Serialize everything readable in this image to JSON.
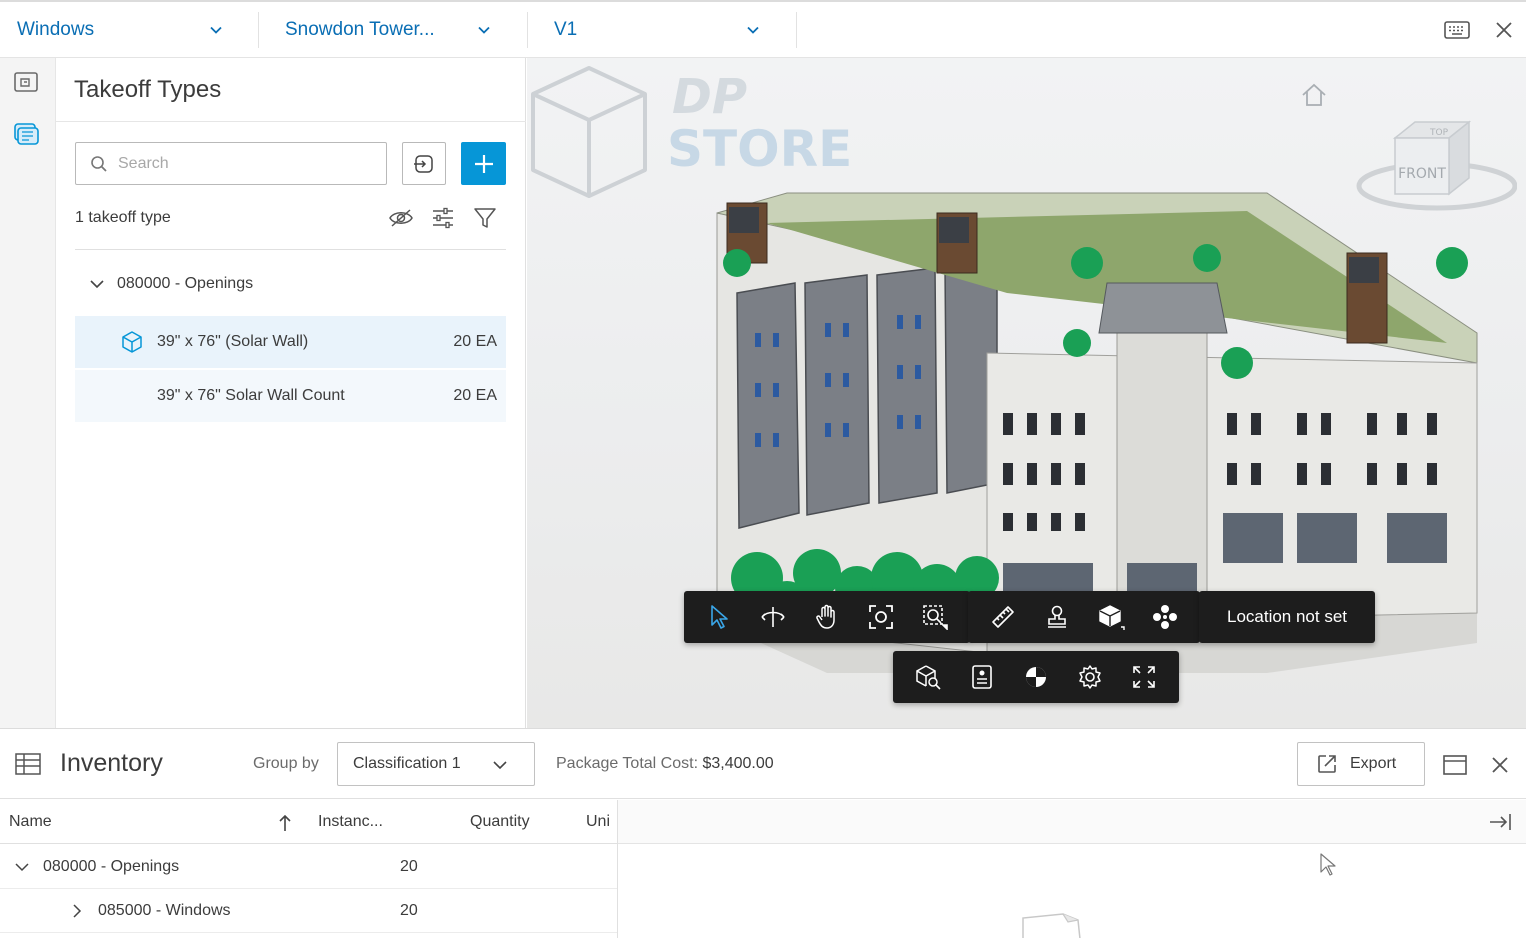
{
  "topbar": {
    "dropdown1": "Windows",
    "dropdown2": "Snowdon Tower...",
    "dropdown3": "V1"
  },
  "panel": {
    "title": "Takeoff Types",
    "search_placeholder": "Search",
    "count_text": "1 takeoff type",
    "group_label": "080000 - Openings",
    "items": [
      {
        "label": "39\" x 76\" (Solar Wall)",
        "qty": "20 EA"
      },
      {
        "label": "39\" x 76\" Solar Wall Count",
        "qty": "20 EA"
      }
    ]
  },
  "viewer": {
    "location_label": "Location not set",
    "viewcube_front": "FRONT",
    "viewcube_top": "TOP",
    "watermark": [
      "DP",
      "STORE"
    ]
  },
  "inventory": {
    "title": "Inventory",
    "group_by_label": "Group by",
    "group_by_value": "Classification 1",
    "package_cost_label": "Package Total Cost:",
    "package_cost_value": "$3,400.00",
    "export_label": "Export",
    "columns": [
      "Name",
      "Instanc...",
      "Quantity",
      "Uni"
    ],
    "rows": [
      {
        "name": "080000 - Openings",
        "instances": "20"
      },
      {
        "name": "085000 - Windows",
        "instances": "20"
      }
    ]
  },
  "colors": {
    "accent": "#0696d7",
    "link": "#0a6eb4",
    "toolbar": "#1d1d1d"
  }
}
